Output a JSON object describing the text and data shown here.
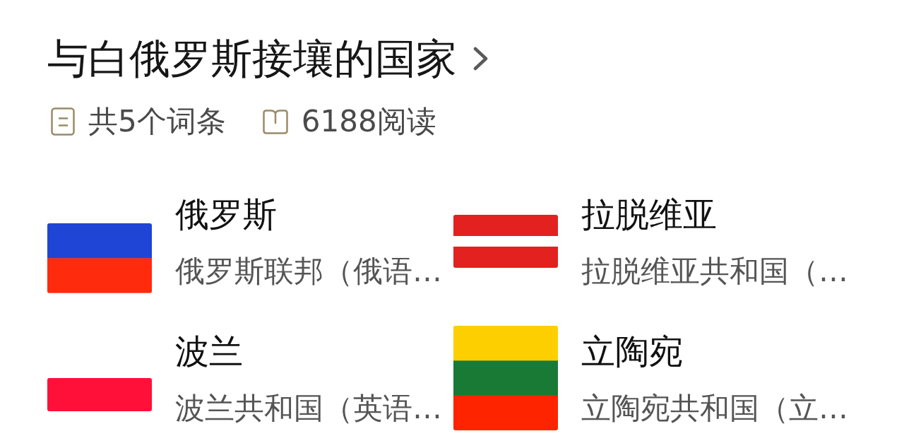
{
  "header": {
    "title": "与白俄罗斯接壤的国家"
  },
  "meta": [
    {
      "kind": "entries",
      "text": "共5个词条"
    },
    {
      "kind": "reads",
      "text": "6188阅读"
    }
  ],
  "countries": [
    {
      "name": "俄罗斯",
      "description": "俄罗斯联邦（俄语…",
      "flag": {
        "kind": "square",
        "stripes": [
          {
            "kind": "blank"
          },
          {
            "kind": "band",
            "color": "#1f45d6"
          },
          {
            "kind": "band",
            "color": "#ff2b0c"
          }
        ]
      }
    },
    {
      "name": "拉脱维亚",
      "description": "拉脱维亚共和国（…",
      "flag": {
        "kind": "long",
        "stripes": [
          {
            "kind": "band",
            "color": "#e3211f"
          },
          {
            "kind": "band",
            "color": "#e3211f"
          },
          {
            "kind": "blank"
          },
          {
            "kind": "band",
            "color": "#e3211f"
          },
          {
            "kind": "band",
            "color": "#e3211f"
          }
        ]
      }
    },
    {
      "name": "波兰",
      "description": "波兰共和国（英语…",
      "flag": {
        "kind": "wide",
        "stripes": [
          {
            "kind": "blank"
          },
          {
            "kind": "band",
            "color": "#ff1038"
          }
        ]
      }
    },
    {
      "name": "立陶宛",
      "description": "立陶宛共和国（立…",
      "flag": {
        "kind": "square",
        "stripes": [
          {
            "kind": "band",
            "color": "#fdcf00"
          },
          {
            "kind": "band",
            "color": "#187a35"
          },
          {
            "kind": "band",
            "color": "#ff2400"
          }
        ]
      }
    }
  ]
}
